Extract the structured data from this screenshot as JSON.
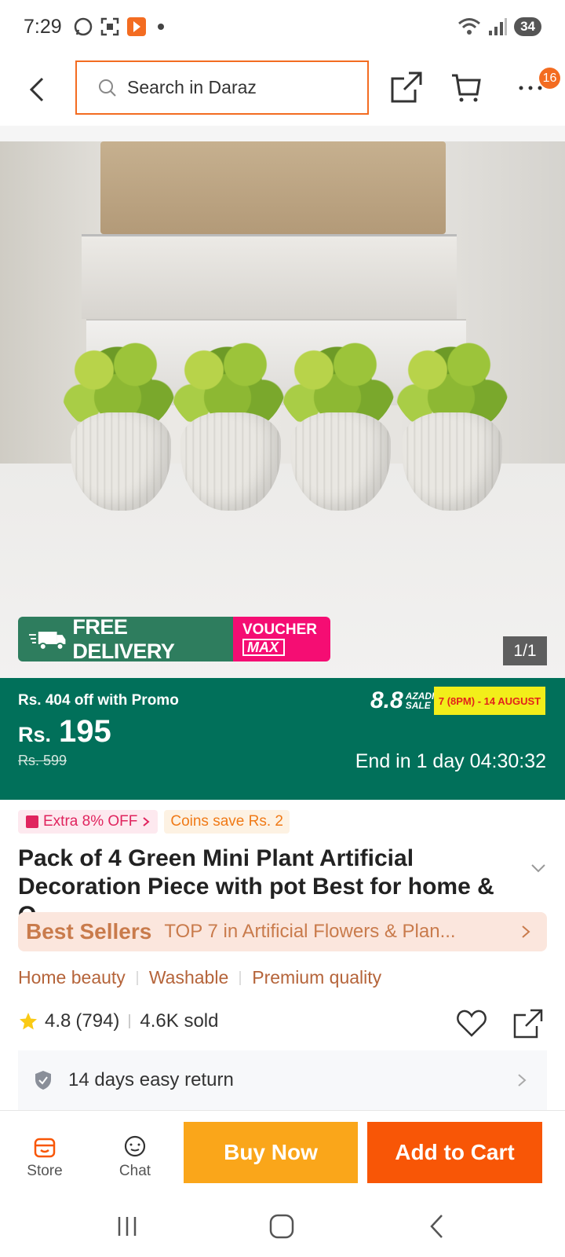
{
  "status_bar": {
    "time": "7:29",
    "battery": "34"
  },
  "header": {
    "search_placeholder": "Search in Daraz",
    "notification_count": "16"
  },
  "product_image": {
    "free_delivery": "FREE DELIVERY",
    "voucher_line1": "VOUCHER",
    "voucher_line2": "MAX",
    "image_counter": "1/1"
  },
  "price": {
    "promo_text": "Rs. 404 off with Promo",
    "currency": "Rs.",
    "current": "195",
    "original": "Rs. 599",
    "sale_number": "8.8",
    "sale_name_line1": "AZADI",
    "sale_name_line2": "SALE",
    "sale_dates": "7 (8PM) - 14 AUGUST",
    "countdown": "End in 1 day 04:30:32"
  },
  "tags": {
    "extra_off": "Extra 8% OFF",
    "coins": "Coins save Rs. 2"
  },
  "product": {
    "title": "Pack of 4 Green Mini Plant Artificial Decoration Piece with pot Best for home & O..."
  },
  "best_sellers": {
    "label": "Best Sellers",
    "text": "TOP 7 in Artificial Flowers & Plan..."
  },
  "features": [
    "Home beauty",
    "Washable",
    "Premium quality"
  ],
  "rating": {
    "score": "4.8",
    "count": "(794)",
    "sold": "4.6K sold"
  },
  "return_policy": "14 days easy return",
  "action_bar": {
    "store": "Store",
    "chat": "Chat",
    "buy_now": "Buy Now",
    "add_to_cart": "Add to Cart"
  },
  "colors": {
    "brand_orange": "#f85606",
    "buy_now": "#faa61a",
    "price_band": "#01705a"
  }
}
